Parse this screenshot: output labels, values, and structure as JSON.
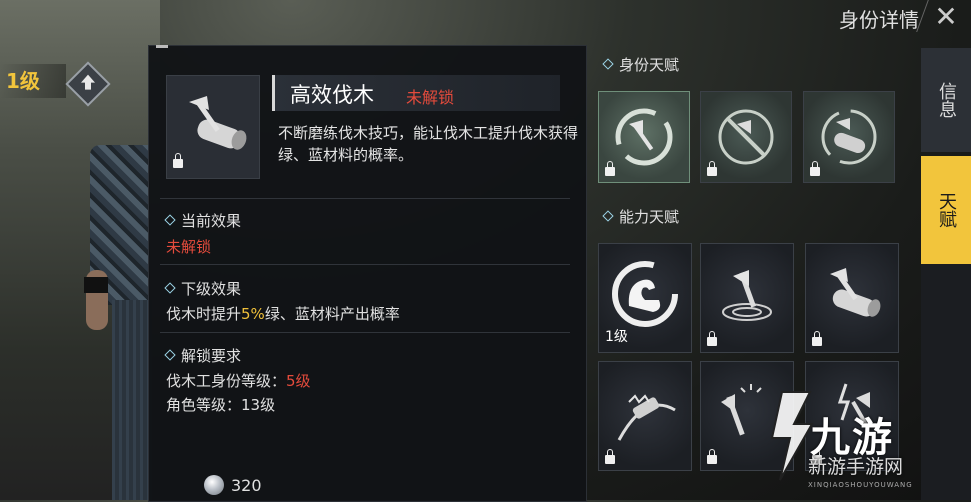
{
  "header": {
    "title": "身份详情",
    "close_icon": "close-icon"
  },
  "left": {
    "level": "1级",
    "upgrade_icon": "level-up-arrow-icon"
  },
  "detail": {
    "skill_name": "高效伐木",
    "lock_status": "未解锁",
    "description": "不断磨练伐木技巧，能让伐木工提升伐木获得绿、蓝材料的概率。",
    "current_effect": {
      "title": "当前效果",
      "value": "未解锁"
    },
    "next_effect": {
      "title": "下级效果",
      "prefix": "伐木时提升",
      "percent": "5%",
      "suffix": "绿、蓝材料产出概率"
    },
    "unlock_req": {
      "title": "解锁要求",
      "line1_label": "伐木工身份等级：",
      "line1_value": "5级",
      "line2_label": "角色等级：",
      "line2_value": "13级"
    },
    "cost": {
      "icon": "silver-coin-icon",
      "value": "320"
    }
  },
  "identity_talents": {
    "label": "身份天赋",
    "tiles": [
      {
        "icon": "axe-circle-icon",
        "locked": true
      },
      {
        "icon": "axe-slash-icon",
        "locked": true
      },
      {
        "icon": "log-circle-icon",
        "locked": true
      }
    ]
  },
  "ability_talents": {
    "label": "能力天赋",
    "tiles": [
      {
        "icon": "flex-arm-icon",
        "level": "1级"
      },
      {
        "icon": "axe-stump-icon",
        "locked": true
      },
      {
        "icon": "axe-log-icon",
        "locked": true
      },
      {
        "icon": "chainsaw-icon",
        "locked": true
      },
      {
        "icon": "double-axe-icon",
        "locked": true
      },
      {
        "icon": "lightning-axe-icon",
        "locked": true
      }
    ]
  },
  "side_tabs": {
    "info": "信息",
    "talent": "天赋"
  },
  "watermark": {
    "main": "九游",
    "sub": "新游手游网",
    "tiny": "XINQIAOSHOUYOUWANG"
  },
  "colors": {
    "accent": "#f2c53c",
    "locked_red": "#e44b3c",
    "highlight_yellow": "#f0c03a"
  }
}
